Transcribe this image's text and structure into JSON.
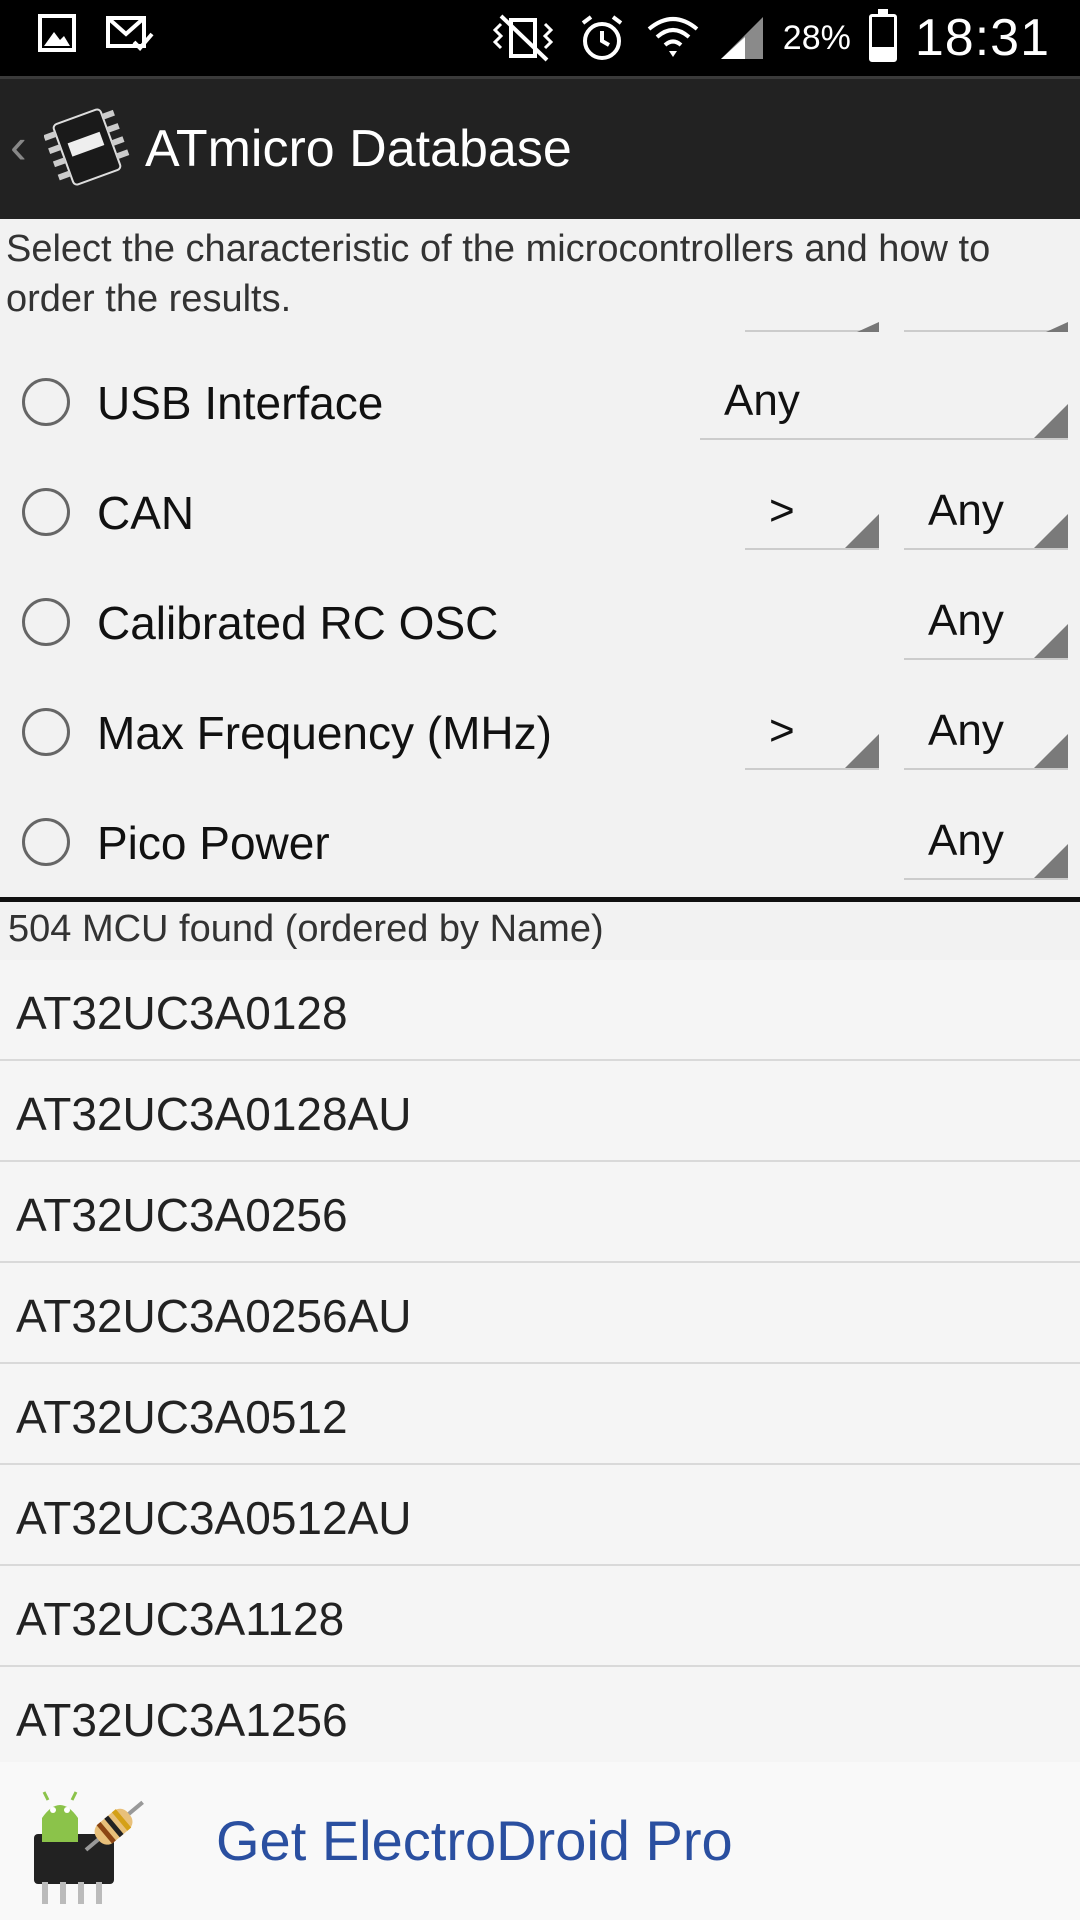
{
  "status_bar": {
    "battery_percent": "28%",
    "battery_level": 0.28,
    "clock": "18:31",
    "icons": [
      "gallery-icon",
      "mail-icon",
      "vibrate-icon",
      "alarm-icon",
      "wifi-icon",
      "signal-icon"
    ]
  },
  "action_bar": {
    "title": "ATmicro Database"
  },
  "filters": {
    "description": "Select the characteristic of the microcontrollers and how to order the results.",
    "rows": [
      {
        "label": "USB Interface",
        "operator": "",
        "value": "Any"
      },
      {
        "label": "CAN",
        "operator": ">",
        "value": "Any"
      },
      {
        "label": "Calibrated RC OSC",
        "operator": "",
        "value": "Any"
      },
      {
        "label": "Max Frequency (MHz)",
        "operator": ">",
        "value": "Any"
      },
      {
        "label": "Pico Power",
        "operator": "",
        "value": "Any"
      }
    ]
  },
  "results": {
    "header": "504 MCU found (ordered by Name)",
    "items": [
      "AT32UC3A0128",
      "AT32UC3A0128AU",
      "AT32UC3A0256",
      "AT32UC3A0256AU",
      "AT32UC3A0512",
      "AT32UC3A0512AU",
      "AT32UC3A1128",
      "AT32UC3A1256"
    ]
  },
  "promo": {
    "label": "Get ElectroDroid Pro"
  },
  "colors": {
    "accent_link": "#2a4fa0",
    "action_bar": "#222222",
    "status_bar": "#000000"
  }
}
